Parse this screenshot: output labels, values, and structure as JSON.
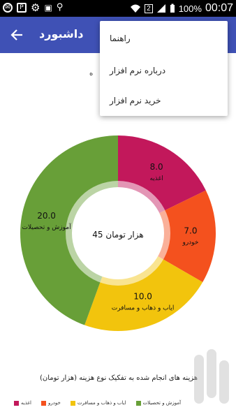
{
  "status_bar": {
    "battery": "100%",
    "time": "00:07",
    "icons": [
      "messenger-icon",
      "p-icon",
      "settings-icon",
      "bag-icon",
      "usb-icon",
      "wifi-icon",
      "sim-2-icon",
      "signal-icon",
      "battery-icon"
    ],
    "sim_label": "2"
  },
  "app_bar": {
    "title": "داشبورد",
    "back_icon": "arrow-back-icon",
    "color": "#3f51b5"
  },
  "overflow_menu": {
    "items": [
      "راهنما",
      "درباره نرم افزار",
      "خرید نرم افزار"
    ]
  },
  "sub_hint": "ه",
  "chart_data": {
    "type": "pie",
    "donut": true,
    "center_label": "45 هزار تومان",
    "title": "هزینه های انجام شده به  تفکیک نوع هزینه (هزار تومان)",
    "slices": [
      {
        "label": "اغذیه",
        "value": 8.0,
        "display": "8.0",
        "color": "#c2185b"
      },
      {
        "label": "خودرو",
        "value": 7.0,
        "display": "7.0",
        "color": "#f4511e"
      },
      {
        "label": "ایاب و ذهاب و مسافرت",
        "value": 10.0,
        "display": "10.0",
        "color": "#f2c40d"
      },
      {
        "label": "آموزش و تحصیلات",
        "value": 20.0,
        "display": "20.0",
        "color": "#689f38"
      }
    ],
    "legend_position": "bottom-left"
  }
}
